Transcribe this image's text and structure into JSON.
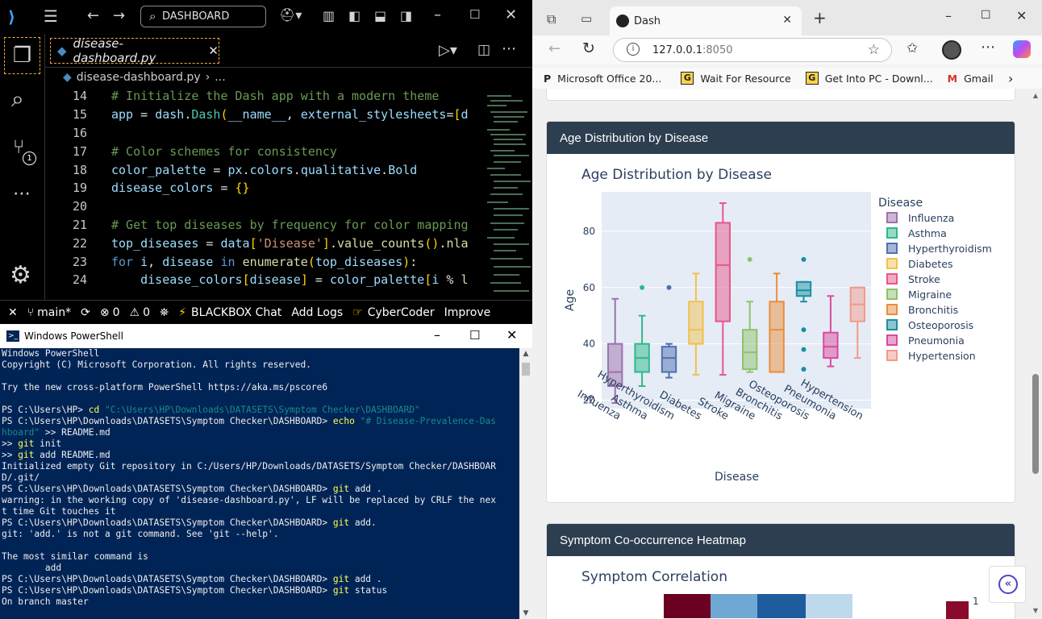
{
  "vscode": {
    "search_label": "DASHBOARD",
    "tab_label": "disease-dashboard.py",
    "breadcrumb_file": "disease-dashboard.py",
    "breadcrumb_more": "...",
    "source_control_badge": "1",
    "code_lines": [
      {
        "n": "14",
        "html": "<span class='cm'># Initialize the Dash app with a modern theme</span>"
      },
      {
        "n": "15",
        "html": "<span class='vr'>app</span> = <span class='vr'>dash</span>.<span class='ty'>Dash</span><span class='br'>(</span><span class='vr'>__name__</span>, <span class='vr'>external_stylesheets</span>=<span class='br'>[</span><span class='vr'>d</span>"
      },
      {
        "n": "16",
        "html": ""
      },
      {
        "n": "17",
        "html": "<span class='cm'># Color schemes for consistency</span>"
      },
      {
        "n": "18",
        "html": "<span class='vr'>color_palette</span> = <span class='vr'>px</span>.<span class='vr'>colors</span>.<span class='vr'>qualitative</span>.<span class='vr'>Bold</span>"
      },
      {
        "n": "19",
        "html": "<span class='vr'>disease_colors</span> = <span class='br'>{}</span>"
      },
      {
        "n": "20",
        "html": ""
      },
      {
        "n": "21",
        "html": "<span class='cm'># Get top diseases by frequency for color mapping</span>"
      },
      {
        "n": "22",
        "html": "<span class='vr'>top_diseases</span> = <span class='vr'>data</span><span class='br'>[</span><span class='st'>'Disease'</span><span class='br'>]</span>.<span class='fn'>value_counts</span><span class='br'>()</span>.<span class='fn'>nla</span>"
      },
      {
        "n": "23",
        "html": "<span class='kw'>for</span> <span class='vr'>i</span>, <span class='vr'>disease</span> <span class='kw'>in</span> <span class='fn'>enumerate</span><span class='br'>(</span><span class='vr'>top_diseases</span><span class='br'>)</span>:"
      },
      {
        "n": "24",
        "html": "    <span class='vr'>disease_colors</span><span class='br'>[</span><span class='vr'>disease</span><span class='br'>]</span> = <span class='vr'>color_palette</span><span class='br'>[</span><span class='vr'>i</span> % <span class='fn'>l</span>"
      }
    ],
    "status": {
      "branch": "main*",
      "errors": "0",
      "warnings": "0",
      "blackbox": "BLACKBOX Chat",
      "add_logs": "Add Logs",
      "cybercoder": "CyberCoder",
      "improve": "Improve"
    }
  },
  "powershell": {
    "title": "Windows PowerShell",
    "lines": [
      "Windows PowerShell",
      "Copyright (C) Microsoft Corporation. All rights reserved.",
      "",
      "Try the new cross-platform PowerShell https://aka.ms/pscore6",
      "",
      "PS C:\\Users\\HP> <span class='y'>cd</span> <span class='g'>\"C:\\Users\\HP\\Downloads\\DATASETS\\Symptom Checker\\DASHBOARD\"</span>",
      "PS C:\\Users\\HP\\Downloads\\DATASETS\\Symptom Checker\\DASHBOARD> <span class='y'>echo</span> <span class='g'>\"# Disease-Prevalence-Das</span>",
      "<span class='g'>hboard\"</span> >> README.md",
      ">> <span class='y'>git</span> init",
      ">> <span class='y'>git</span> add README.md",
      "Initialized empty Git repository in C:/Users/HP/Downloads/DATASETS/Symptom Checker/DASHBOAR",
      "D/.git/",
      "PS C:\\Users\\HP\\Downloads\\DATASETS\\Symptom Checker\\DASHBOARD> <span class='y'>git</span> add .",
      "warning: in the working copy of 'disease-dashboard.py', LF will be replaced by CRLF the nex",
      "t time Git touches it",
      "PS C:\\Users\\HP\\Downloads\\DATASETS\\Symptom Checker\\DASHBOARD> <span class='y'>git</span> add.",
      "git: 'add.' is not a git command. See 'git --help'.",
      "",
      "The most similar command is",
      "        add",
      "PS C:\\Users\\HP\\Downloads\\DATASETS\\Symptom Checker\\DASHBOARD> <span class='y'>git</span> add .",
      "PS C:\\Users\\HP\\Downloads\\DATASETS\\Symptom Checker\\DASHBOARD> <span class='y'>git</span> status",
      "On branch master"
    ]
  },
  "browser": {
    "tab_title": "Dash",
    "url_host": "127.0.0.1",
    "url_port": ":8050",
    "bookmarks": [
      "Microsoft Office 20...",
      "Wait For Resource",
      "Get Into PC - Downl...",
      "Gmail"
    ],
    "card1_title": "Age Distribution by Disease",
    "card2_title": "Symptom Co-occurrence Heatmap",
    "heatmap_title": "Symptom Correlation",
    "heatmap_scale_label": "1"
  },
  "chart_data": {
    "type": "box",
    "title": "Age Distribution by Disease",
    "xlabel": "Disease",
    "ylabel": "Age",
    "legend_title": "Disease",
    "ylim": [
      17,
      94
    ],
    "yticks": [
      20,
      40,
      60,
      80
    ],
    "series": [
      {
        "name": "Influenza",
        "color": "#9b72aa",
        "min": 19,
        "q1": 25,
        "median": 30,
        "q3": 40,
        "max": 56,
        "outliers": []
      },
      {
        "name": "Asthma",
        "color": "#2eb98a",
        "min": 25,
        "q1": 30,
        "median": 35,
        "q3": 40,
        "max": 50,
        "outliers": [
          60
        ]
      },
      {
        "name": "Hyperthyroidism",
        "color": "#4f6fb0",
        "min": 28,
        "q1": 30,
        "median": 35,
        "q3": 39,
        "max": 40,
        "outliers": [
          60
        ]
      },
      {
        "name": "Diabetes",
        "color": "#f2c14e",
        "min": 29,
        "q1": 40,
        "median": 45,
        "q3": 55,
        "max": 65,
        "outliers": []
      },
      {
        "name": "Stroke",
        "color": "#e8578a",
        "min": 29,
        "q1": 48,
        "median": 68,
        "q3": 83,
        "max": 90,
        "outliers": []
      },
      {
        "name": "Migraine",
        "color": "#8ec26c",
        "min": 30,
        "q1": 31,
        "median": 37,
        "q3": 45,
        "max": 55,
        "outliers": [
          70
        ]
      },
      {
        "name": "Bronchitis",
        "color": "#e98e3c",
        "min": 30,
        "q1": 30,
        "median": 45,
        "q3": 55,
        "max": 65,
        "outliers": []
      },
      {
        "name": "Osteoporosis",
        "color": "#1a8fa0",
        "min": 55,
        "q1": 57,
        "median": 59,
        "q3": 62,
        "max": 62,
        "outliers": [
          31,
          38,
          45,
          70
        ]
      },
      {
        "name": "Pneumonia",
        "color": "#d94a9d",
        "min": 32,
        "q1": 35,
        "median": 39,
        "q3": 44,
        "max": 57,
        "outliers": []
      },
      {
        "name": "Hypertension",
        "color": "#f29a8a",
        "min": 35,
        "q1": 48,
        "median": 54,
        "q3": 60,
        "max": 60,
        "outliers": []
      }
    ]
  }
}
